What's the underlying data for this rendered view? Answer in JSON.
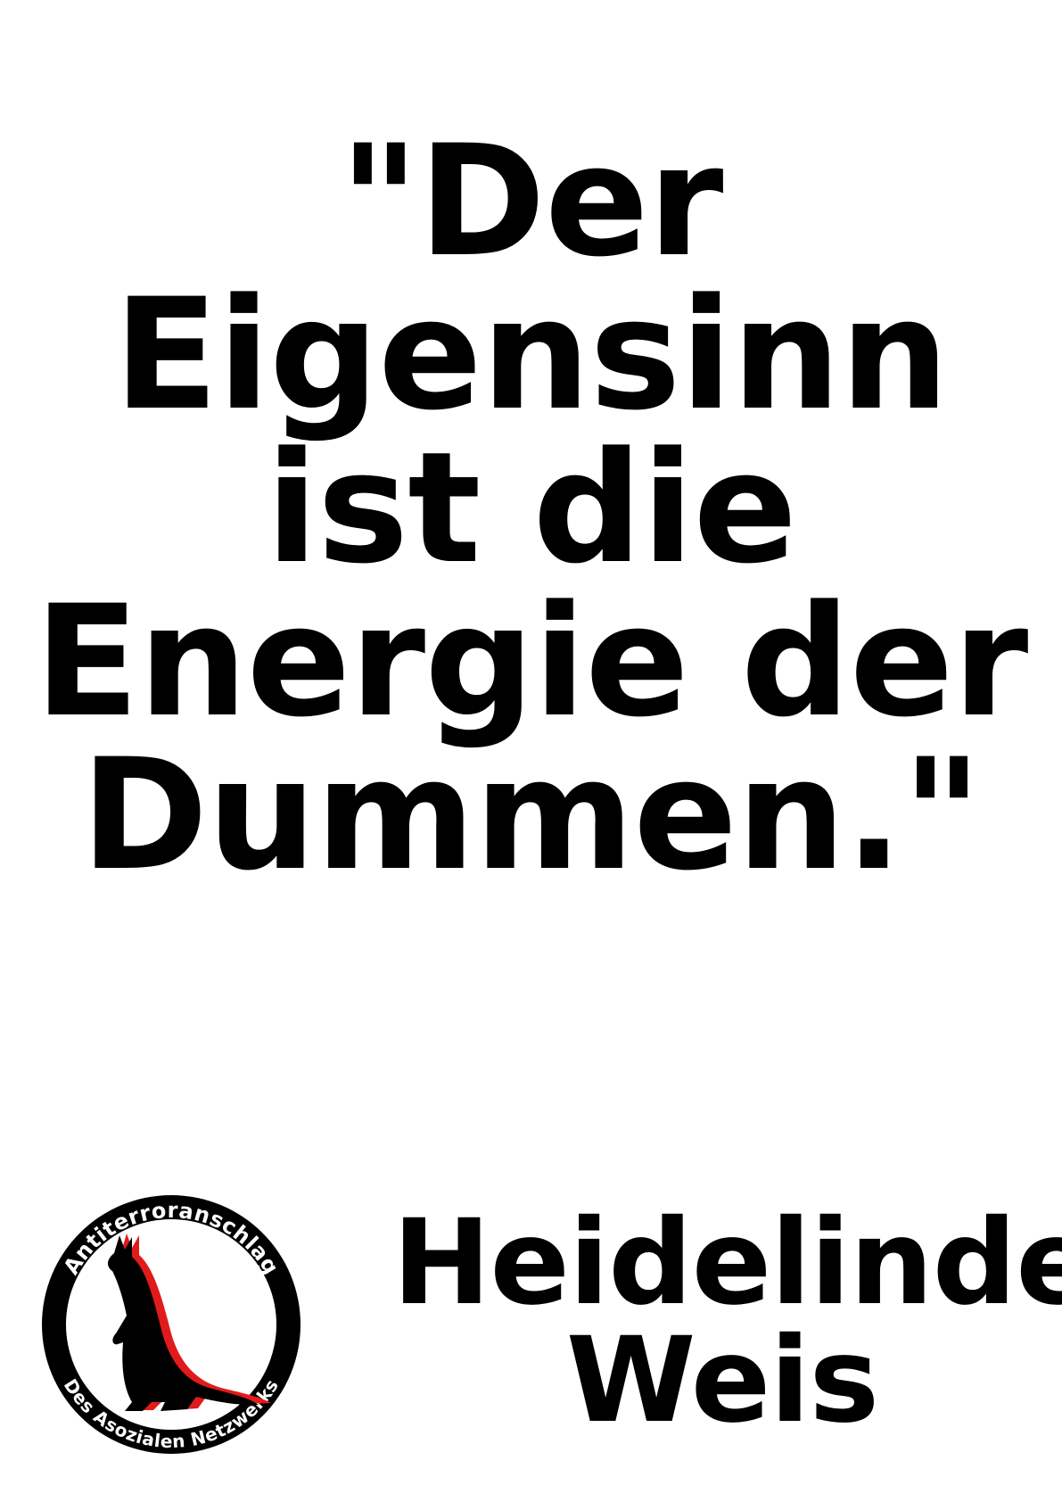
{
  "quote": {
    "lines": [
      "\"Der",
      "Eigensinn",
      "ist die",
      "Energie der",
      "Dummen.\""
    ]
  },
  "author": {
    "lines": [
      "Heidelinde",
      "Weis"
    ]
  },
  "logo": {
    "top_text": "Antiterroranschlag",
    "bottom_text": "Des Asozialen Netzwerks",
    "icon": "kangaroo-icon",
    "colors": {
      "ring": "#000000",
      "silhouette": "#000000",
      "shadow": "#e11b1b"
    }
  }
}
